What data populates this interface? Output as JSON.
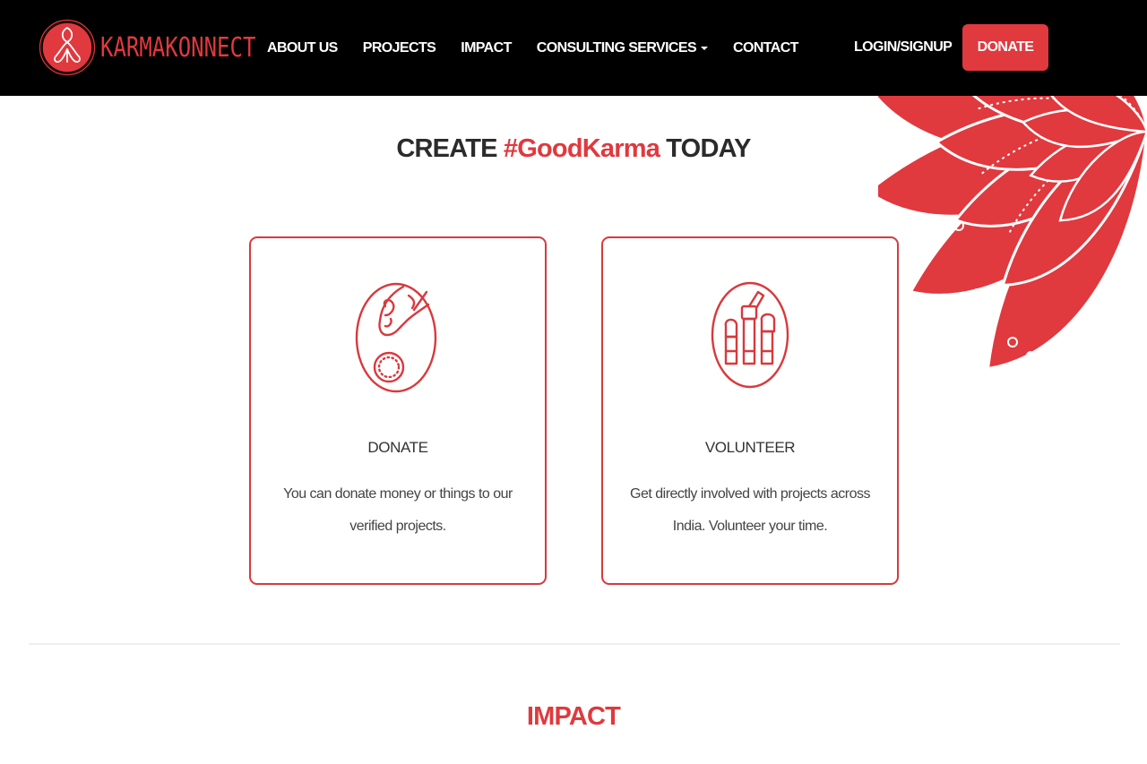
{
  "brand": {
    "name": "KARMAKONNECT",
    "logo_icon": "karma-knot-logo"
  },
  "nav": {
    "items": [
      {
        "label": "ABOUT US"
      },
      {
        "label": "PROJECTS"
      },
      {
        "label": "IMPACT"
      },
      {
        "label": "CONSULTING SERVICES"
      },
      {
        "label": "CONTACT"
      }
    ],
    "login_label": "LOGIN/SIGNUP",
    "donate_label": "DONATE"
  },
  "hero": {
    "prefix": "CREATE",
    "accent": "#GoodKarma",
    "suffix": "TODAY"
  },
  "cards": [
    {
      "icon": "hand-coin-icon",
      "title": "DONATE",
      "description": "You can donate money or things to our verified projects."
    },
    {
      "icon": "raised-fists-icon",
      "title": "VOLUNTEER",
      "description": "Get directly involved with projects across India. Volunteer your time."
    }
  ],
  "impact": {
    "title": "IMPACT"
  },
  "colors": {
    "accent": "#e0393e",
    "header_bg": "#000000",
    "card_border": "#d8393d",
    "text": "#333333"
  }
}
